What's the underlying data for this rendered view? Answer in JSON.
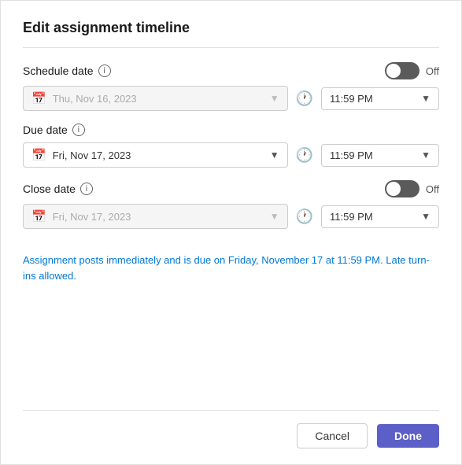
{
  "dialog": {
    "title": "Edit assignment timeline",
    "schedule_date": {
      "label": "Schedule date",
      "toggle_label": "Off",
      "toggle_state": "off",
      "date_placeholder": "Thu, Nov 16, 2023",
      "time_value": "11:59 PM",
      "disabled": true
    },
    "due_date": {
      "label": "Due date",
      "date_value": "Fri, Nov 17, 2023",
      "time_value": "11:59 PM",
      "disabled": false
    },
    "close_date": {
      "label": "Close date",
      "toggle_label": "Off",
      "toggle_state": "off",
      "date_placeholder": "Fri, Nov 17, 2023",
      "time_value": "11:59 PM",
      "disabled": true
    },
    "info_message": "Assignment posts immediately and is due on Friday, November 17 at 11:59 PM. Late turn-ins allowed.",
    "footer": {
      "cancel_label": "Cancel",
      "done_label": "Done"
    }
  }
}
